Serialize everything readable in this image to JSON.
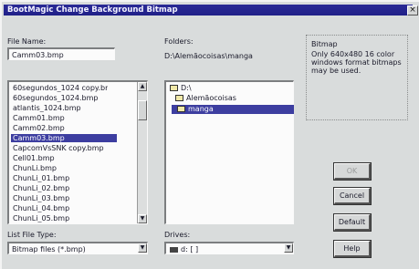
{
  "window": {
    "title": "BootMagic Change Background Bitmap",
    "close_label": "×"
  },
  "file_name": {
    "label": "File Name:",
    "value": "Camm03.bmp"
  },
  "files": [
    "60segundos_1024 copy.bm",
    "60segundos_1024.bmp",
    "atlantis_1024.bmp",
    "Camm01.bmp",
    "Camm02.bmp",
    "Camm03.bmp",
    "CapcomVsSNK copy.bmp",
    "Cell01.bmp",
    "ChunLi.bmp",
    "ChunLi_01.bmp",
    "ChunLi_02.bmp",
    "ChunLi_03.bmp",
    "ChunLi_04.bmp",
    "ChunLi_05.bmp"
  ],
  "selected_file_index": 5,
  "folders": {
    "label": "Folders:",
    "path": "D:\\Alemãocoisas\\manga",
    "items": [
      "D:\\",
      "Alemãocoisas",
      "manga"
    ]
  },
  "bitmap_info": {
    "title": "Bitmap",
    "description": "Only 640x480 16 color windows format bitmaps may be used."
  },
  "buttons": {
    "ok": "OK",
    "cancel": "Cancel",
    "default": "Default",
    "help": "Help"
  },
  "list_file_type": {
    "label": "List File Type:",
    "value": "Bitmap files (*.bmp)"
  },
  "drives": {
    "label": "Drives:",
    "value": "d: [ ]"
  },
  "icons": {
    "scroll_up": "▲",
    "scroll_down": "▼",
    "dropdown": "▼"
  }
}
